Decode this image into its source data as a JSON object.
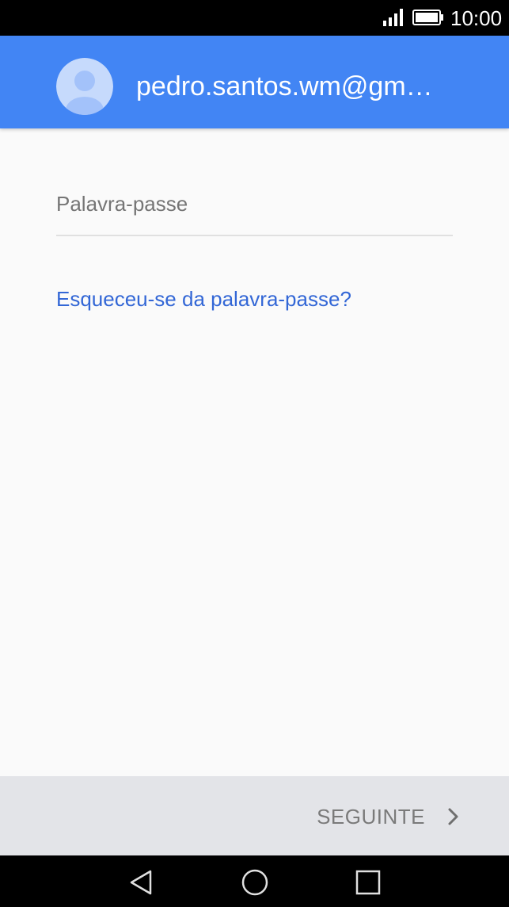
{
  "status_bar": {
    "time": "10:00",
    "signal_icon": "signal-bars-icon",
    "battery_icon": "battery-full-icon"
  },
  "header": {
    "email": "pedro.santos.wm@gm…",
    "avatar_icon": "person-avatar-icon",
    "colors": {
      "background": "#4285f4",
      "avatar_bg": "#c6dafc",
      "avatar_figure": "#a3c2fa"
    }
  },
  "password_field": {
    "label": "Palavra-passe",
    "value": ""
  },
  "forgot_password_link": "Esqueceu-se da palavra-passe?",
  "footer": {
    "next_label": "SEGUINTE",
    "next_icon": "chevron-right-icon"
  },
  "nav_bar": {
    "back_icon": "back-triangle-icon",
    "home_icon": "home-circle-icon",
    "recents_icon": "recents-square-icon"
  },
  "colors": {
    "link": "#3367d6",
    "page_background": "#fafafa",
    "footer_background": "#e3e4e8"
  }
}
